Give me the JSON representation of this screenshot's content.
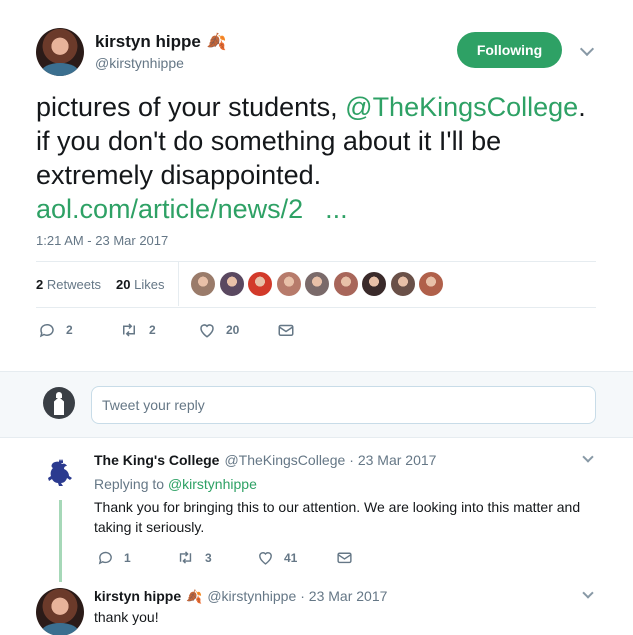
{
  "main_tweet": {
    "author_name": "kirstyn hippe",
    "author_emoji": "🍂",
    "author_handle": "@kirstynhippe",
    "follow_label": "Following",
    "text_part1": "pictures of your students, ",
    "mention": "@TheKingsCollege",
    "text_part2": ". if you don't do something about it I'll be extremely disappointed. ",
    "link_text": "aol.com/article/news/2",
    "link_ellipsis": "...",
    "timestamp": "1:21 AM - 23 Mar 2017",
    "retweets_count": "2",
    "retweets_label": "Retweets",
    "likes_count": "20",
    "likes_label": "Likes",
    "reply_count": "2",
    "retweet_count": "2",
    "like_count": "20"
  },
  "liker_avatar_colors": [
    "#9a7b6a",
    "#5a4860",
    "#d23a2a",
    "#b77b6b",
    "#7a6a6a",
    "#a8665a",
    "#3a2a2a",
    "#6a5048",
    "#b0604a"
  ],
  "reply_box": {
    "placeholder": "Tweet your reply"
  },
  "replies": [
    {
      "author_name": "The King's College",
      "author_handle": "@TheKingsCollege",
      "date": "· 23 Mar 2017",
      "replying_prefix": "Replying to",
      "replying_to": "@kirstynhippe",
      "text": "Thank you for bringing this to our attention. We are looking into this matter and taking it seriously.",
      "reply_count": "1",
      "retweet_count": "3",
      "like_count": "41"
    },
    {
      "author_name": "kirstyn hippe",
      "author_emoji": "🍂",
      "author_handle": "@kirstynhippe",
      "date": "· 23 Mar 2017",
      "text": "thank you!"
    }
  ],
  "colors": {
    "accent_green": "#2ea165",
    "secondary_text": "#657786",
    "divider": "#e6ecf0"
  }
}
